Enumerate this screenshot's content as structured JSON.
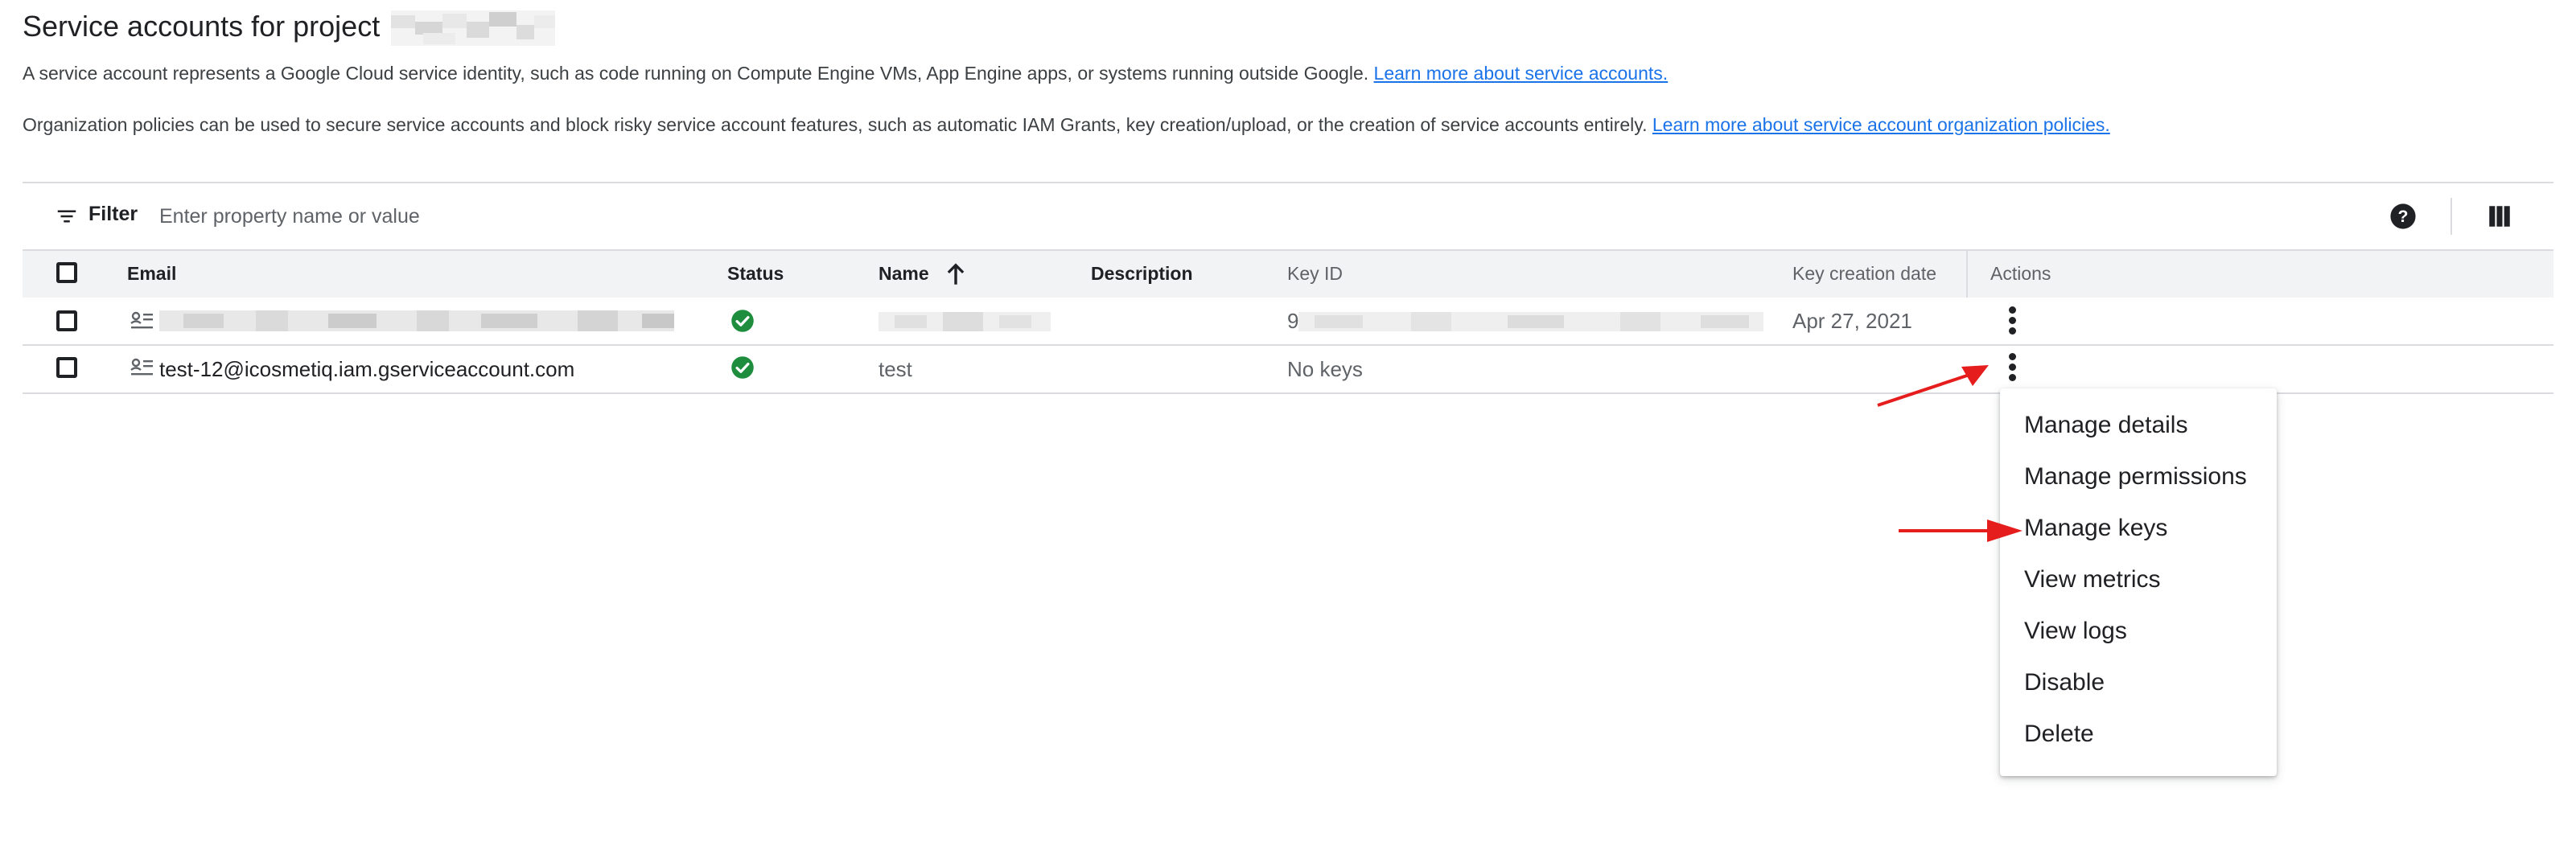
{
  "page": {
    "title": "Service accounts for project",
    "intro_text": "A service account represents a Google Cloud service identity, such as code running on Compute Engine VMs, App Engine apps, or systems running outside Google.",
    "intro_link": "Learn more about service accounts.",
    "policy_text": "Organization policies can be used to secure service accounts and block risky service account features, such as automatic IAM Grants, key creation/upload, or the creation of service accounts entirely.",
    "policy_link": "Learn more about service account organization policies."
  },
  "filter": {
    "label": "Filter",
    "placeholder": "Enter property name or value",
    "filter_icon": "filter-list-icon",
    "help_icon": "help-icon",
    "columns_icon": "column-display-icon"
  },
  "table": {
    "headers": {
      "email": "Email",
      "status": "Status",
      "name": "Name",
      "description": "Description",
      "key_id": "Key ID",
      "key_creation_date": "Key creation date",
      "actions": "Actions"
    },
    "sort_icon": "arrow-upward-icon",
    "rows": [
      {
        "email": "",
        "status": "enabled",
        "name": "",
        "description": "",
        "key_id": "9",
        "key_creation_date": "Apr 27, 2021"
      },
      {
        "email": "test-12@icosmetiq.iam.gserviceaccount.com",
        "status": "enabled",
        "name": "test",
        "description": "",
        "key_id": "No keys",
        "key_creation_date": ""
      }
    ]
  },
  "menu": {
    "items": [
      "Manage details",
      "Manage permissions",
      "Manage keys",
      "View metrics",
      "View logs",
      "Disable",
      "Delete"
    ]
  },
  "colors": {
    "link": "#1a73e8",
    "status_ok": "#1e8e3e",
    "annotation_arrow": "#e51d1d",
    "header_bg": "#f1f3f4",
    "divider": "#dadce0"
  }
}
